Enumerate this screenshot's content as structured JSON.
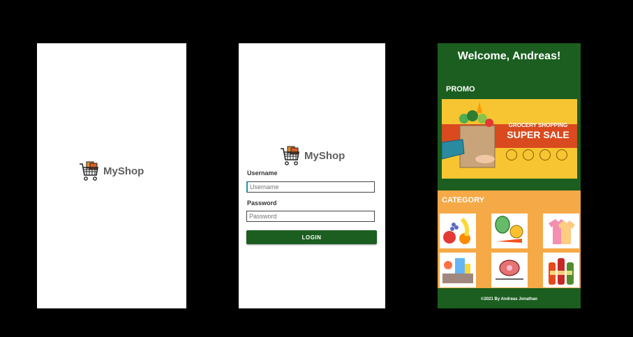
{
  "splash": {
    "logo_text": "MyShop",
    "logo_icon": "shopping-cart-icon"
  },
  "login": {
    "logo_text": "MyShop",
    "logo_icon": "shopping-cart-icon",
    "username_label": "Username",
    "username_placeholder": "Username",
    "password_label": "Password",
    "password_placeholder": "Password",
    "login_button": "LOGIN"
  },
  "home": {
    "welcome": "Welcome, Andreas!",
    "promo_heading": "PROMO",
    "banner": {
      "line1": "GROCERY SHOPPING",
      "line2": "SUPER SALE"
    },
    "category_heading": "CATEGORY",
    "categories": [
      {
        "icon": "fruits-icon"
      },
      {
        "icon": "vegetables-icon"
      },
      {
        "icon": "clothes-icon"
      },
      {
        "icon": "groceries-icon"
      },
      {
        "icon": "meat-icon"
      },
      {
        "icon": "drinks-icon"
      }
    ],
    "footer": "©2021 By Andreas Jonathan"
  },
  "colors": {
    "primary_green": "#1b5e20",
    "category_orange": "#f5a947",
    "banner_yellow": "#f7c531",
    "banner_red": "#d94a1e"
  }
}
